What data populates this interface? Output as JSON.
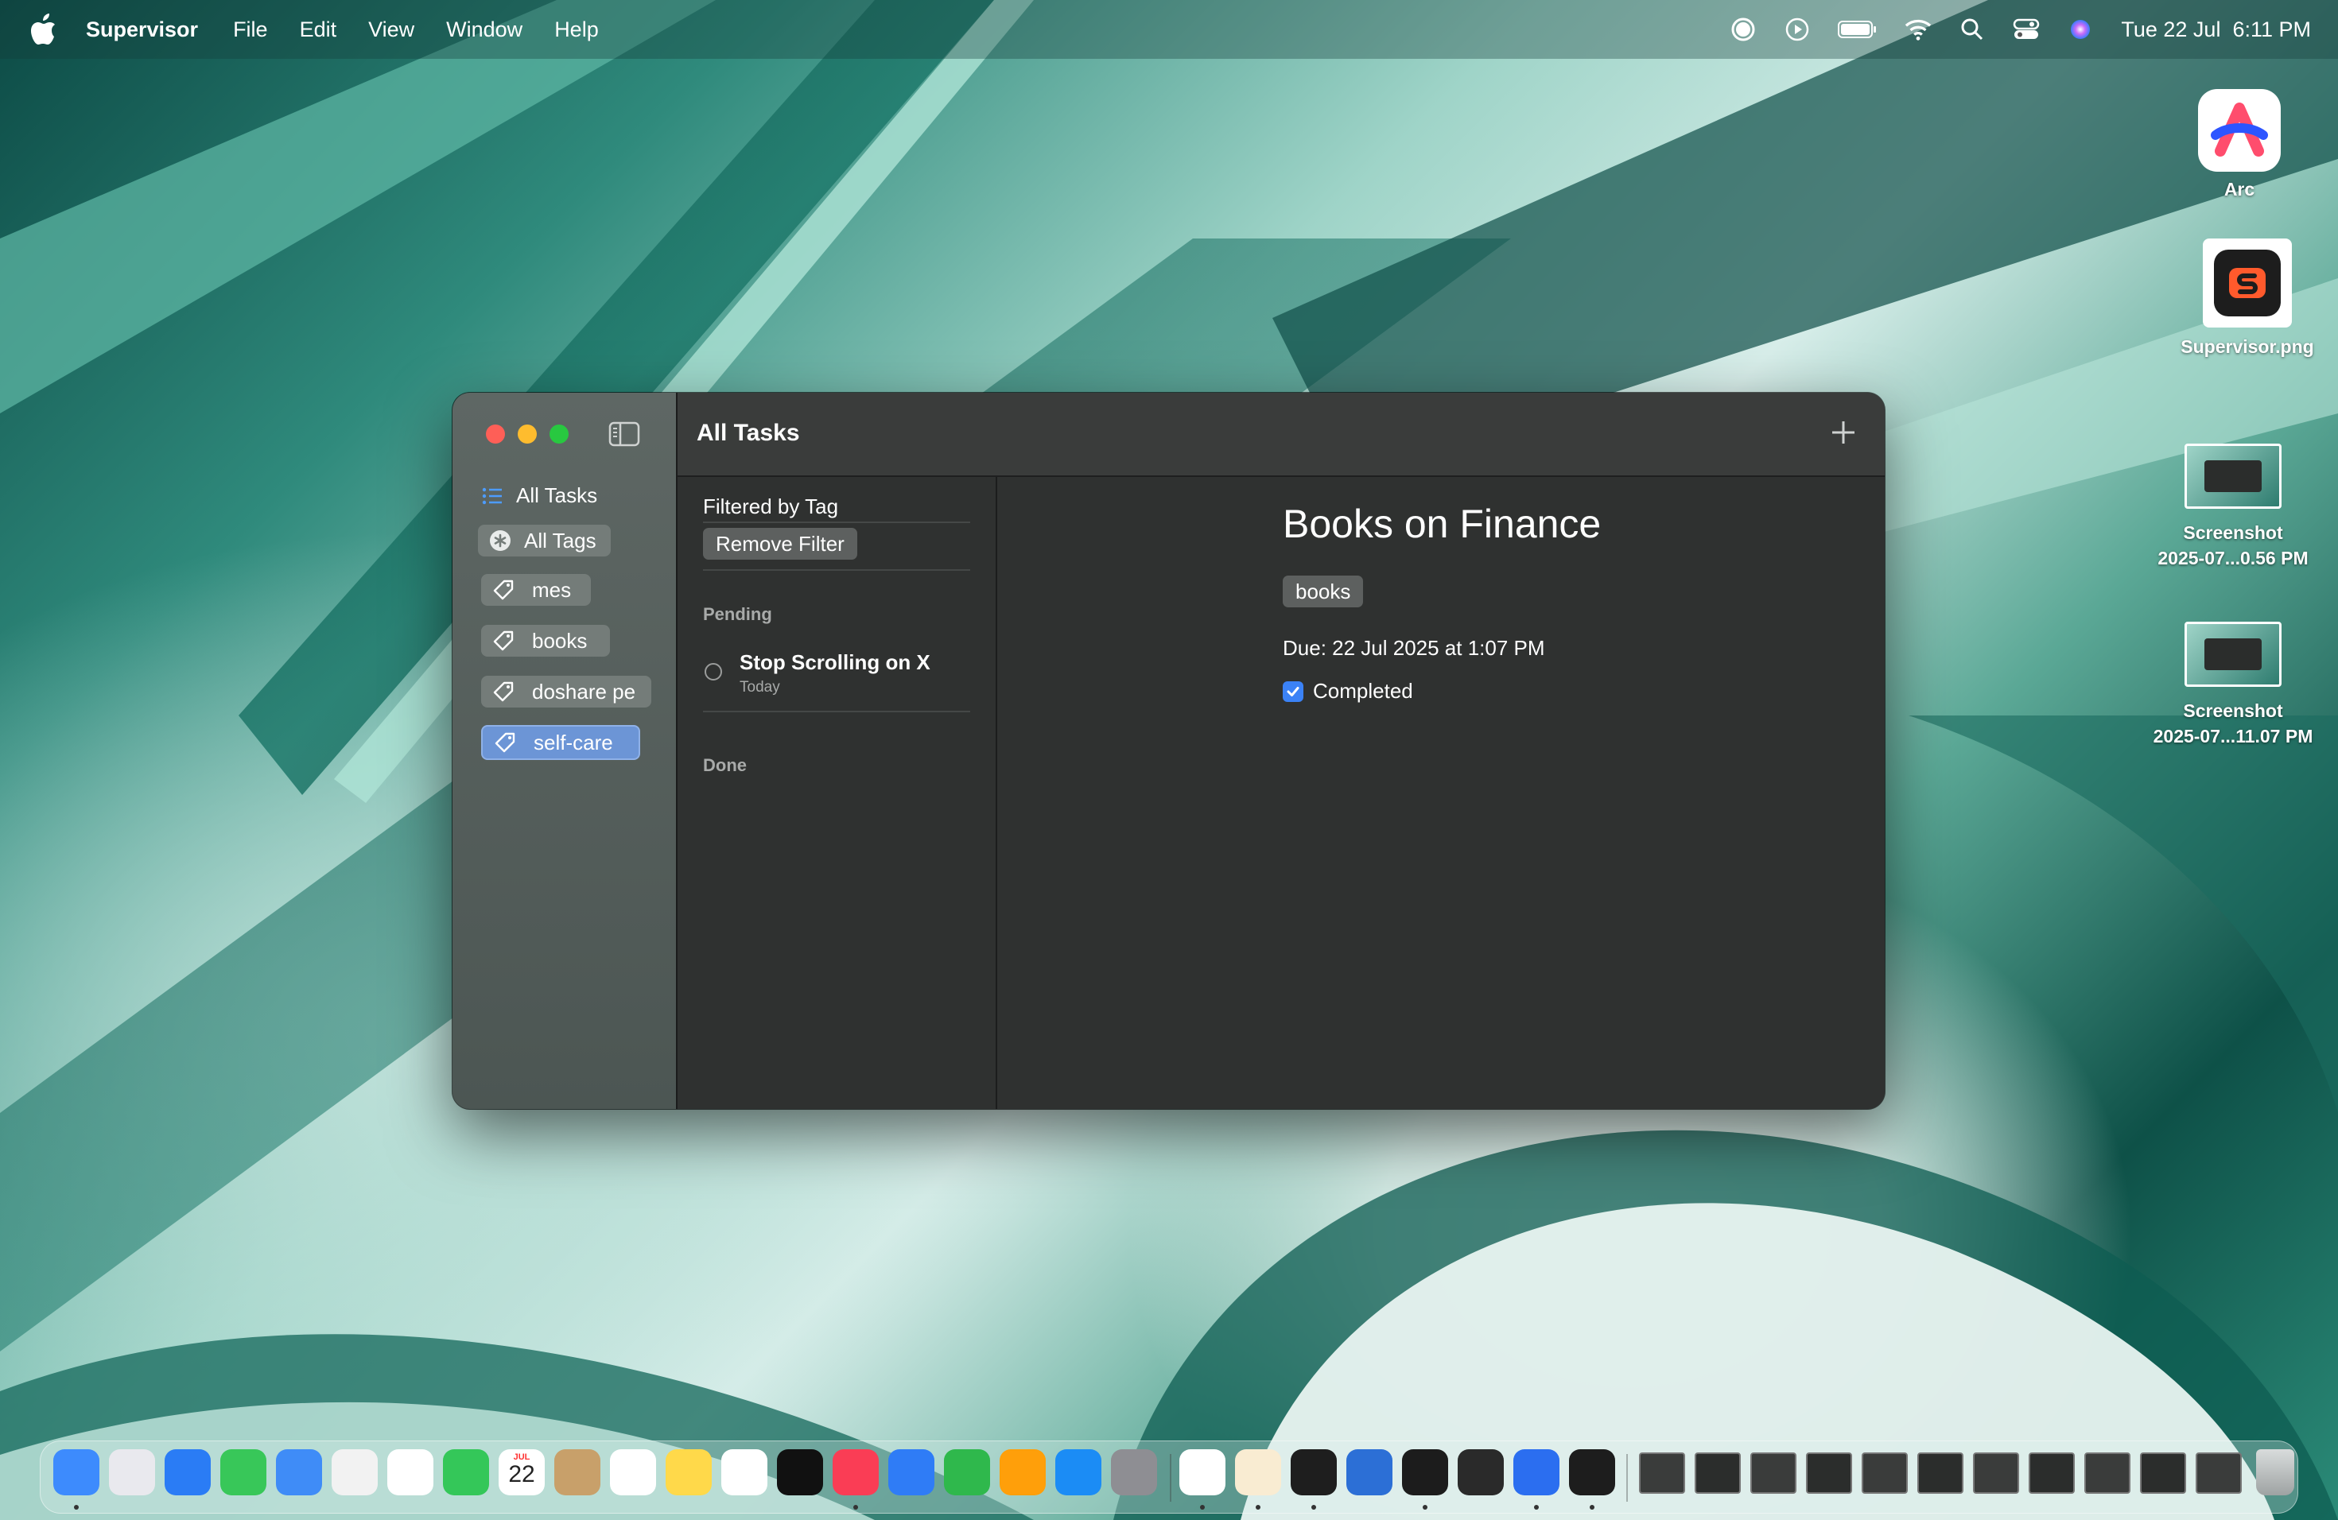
{
  "menubar": {
    "app_name": "Supervisor",
    "menus": [
      "File",
      "Edit",
      "View",
      "Window",
      "Help"
    ],
    "clock": "Tue 22 Jul  6:11 PM",
    "status_icons": [
      "record-icon",
      "play-icon",
      "battery-icon",
      "wifi-icon",
      "search-icon",
      "control-center-icon",
      "siri-icon"
    ]
  },
  "desktop": {
    "icons": [
      {
        "label": "Arc",
        "icon": "arc-icon"
      },
      {
        "label": "Supervisor.png",
        "icon": "supervisor-file-icon"
      },
      {
        "label_line1": "Screenshot",
        "label_line2": "2025-07...0.56 PM",
        "icon": "screenshot-file-icon"
      },
      {
        "label_line1": "Screenshot",
        "label_line2": "2025-07...11.07 PM",
        "icon": "screenshot-file-icon"
      }
    ]
  },
  "window": {
    "title": "All Tasks",
    "sidebar": {
      "all_tasks_label": "All Tasks",
      "all_tags_label": "All Tags",
      "tags": [
        {
          "label": "mes",
          "selected": false
        },
        {
          "label": "books",
          "selected": false
        },
        {
          "label": "doshare pe",
          "selected": false
        },
        {
          "label": "self-care",
          "selected": true
        }
      ]
    },
    "list": {
      "filter_label": "Filtered by Tag",
      "remove_filter_label": "Remove Filter",
      "pending_label": "Pending",
      "done_label": "Done",
      "tasks": [
        {
          "name": "Stop Scrolling on X",
          "when": "Today",
          "completed": false
        }
      ]
    },
    "detail": {
      "title": "Books on Finance",
      "tag": "books",
      "due": "Due: 22 Jul 2025 at 1:07 PM",
      "completed_label": "Completed",
      "completed": true
    }
  },
  "dock": {
    "apps": [
      "finder-icon",
      "launchpad-icon",
      "safari-icon",
      "messages-icon",
      "mail-icon",
      "maps-icon",
      "photos-icon",
      "facetime-icon",
      "calendar-icon",
      "contacts-icon",
      "reminders-icon",
      "notes-icon",
      "freeform-icon",
      "appletv-icon",
      "music-icon",
      "keynote-icon",
      "numbers-icon",
      "pages-icon",
      "appstore-icon",
      "system-settings-icon",
      "chrome-icon",
      "arc-icon",
      "terminal-icon",
      "xcode-icon",
      "activity-monitor-icon",
      "raycast-icon",
      "screen-recorder-icon",
      "supervisor-icon"
    ],
    "calendar_day": "22",
    "calendar_month": "JUL",
    "recent_windows": 11
  }
}
